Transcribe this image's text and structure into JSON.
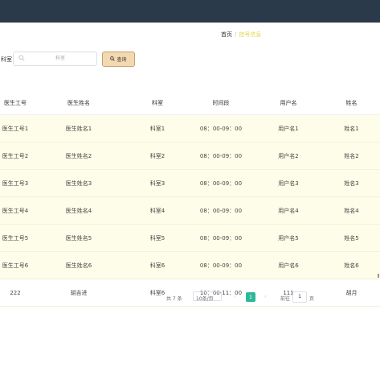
{
  "breadcrumb": {
    "home": "首页",
    "separator": "/",
    "current": "挂号信息"
  },
  "search": {
    "label": "科室",
    "placeholder": "科室",
    "button": "查询",
    "search_icon": "search-icon"
  },
  "table": {
    "columns": [
      "医生工号",
      "医生姓名",
      "科室",
      "时间段",
      "用户名",
      "姓名"
    ],
    "rows": [
      [
        "医生工号1",
        "医生姓名1",
        "科室1",
        "08：00-09：00",
        "用户名1",
        "姓名1"
      ],
      [
        "医生工号2",
        "医生姓名2",
        "科室2",
        "08：00-09：00",
        "用户名2",
        "姓名2"
      ],
      [
        "医生工号3",
        "医生姓名3",
        "科室3",
        "08：00-09：00",
        "用户名3",
        "姓名3"
      ],
      [
        "医生工号4",
        "医生姓名4",
        "科室4",
        "08：00-09：00",
        "用户名4",
        "姓名4"
      ],
      [
        "医生工号5",
        "医生姓名5",
        "科室5",
        "08：00-09：00",
        "用户名5",
        "姓名5"
      ],
      [
        "医生工号6",
        "医生姓名6",
        "科室6",
        "08：00-09：00",
        "用户名6",
        "姓名6"
      ],
      [
        "222",
        "胡吉进",
        "科室6",
        "10：00-11：00",
        "111",
        "胡月"
      ]
    ]
  },
  "pagination": {
    "total": "共 7 条",
    "page_size": "10条/页",
    "current_page": "1",
    "goto_label": "前往",
    "goto_value": "1",
    "goto_unit": "页",
    "prev_icon": "chevron-left-icon",
    "next_icon": "chevron-right-icon"
  },
  "colors": {
    "header_bar": "#2b3a4b",
    "row_highlight": "#fdfde9",
    "accent_button": "#f3d9b1",
    "active_page": "#2eb89a",
    "breadcrumb_current": "#e0d64a"
  }
}
